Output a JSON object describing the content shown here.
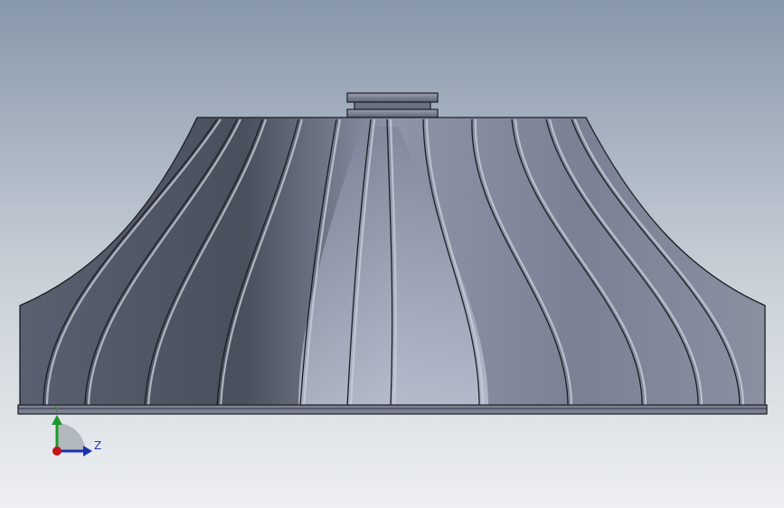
{
  "viewport": {
    "background_top": "#8797aa",
    "background_bottom": "#eef0f2",
    "model": "impeller",
    "view": "front"
  },
  "triad": {
    "z_label": "Z",
    "y_label": "Y",
    "x_color": "#c0141d",
    "y_color": "#1c9a2b",
    "z_color": "#1f2fb0"
  },
  "colors": {
    "hub_dark": "#4a4f5c",
    "hub_mid": "#6c7385",
    "hub_light": "#9ea4b6",
    "blade_light": "#b8bed0",
    "edge": "#1c1e24"
  }
}
